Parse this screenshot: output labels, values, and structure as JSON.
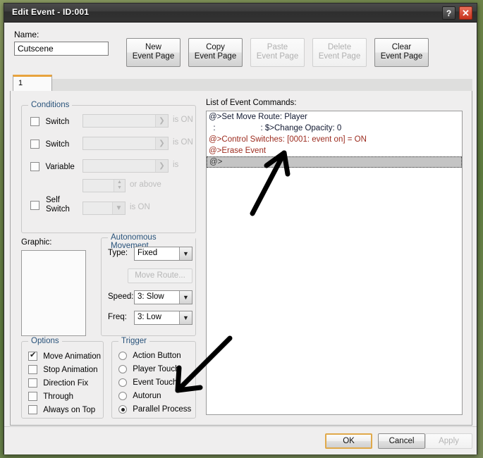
{
  "window": {
    "title": "Edit Event - ID:001",
    "help_button": "?",
    "close_button": "✕"
  },
  "name_field": {
    "label": "Name:",
    "value": "Cutscene"
  },
  "page_buttons": [
    {
      "line1": "New",
      "line2": "Event Page",
      "enabled": true
    },
    {
      "line1": "Copy",
      "line2": "Event Page",
      "enabled": true
    },
    {
      "line1": "Paste",
      "line2": "Event Page",
      "enabled": false
    },
    {
      "line1": "Delete",
      "line2": "Event Page",
      "enabled": false
    },
    {
      "line1": "Clear",
      "line2": "Event Page",
      "enabled": true
    }
  ],
  "tabs": [
    {
      "label": "1",
      "active": true
    }
  ],
  "conditions": {
    "legend": "Conditions",
    "rows": [
      {
        "label": "Switch",
        "checked": false,
        "value": "",
        "suffix": "is ON"
      },
      {
        "label": "Switch",
        "checked": false,
        "value": "",
        "suffix": "is ON"
      },
      {
        "label": "Variable",
        "checked": false,
        "value": "",
        "suffix": "is"
      },
      {
        "label": "",
        "checked": null,
        "value": "",
        "suffix": "or above"
      },
      {
        "label": "Self Switch",
        "checked": false,
        "value": "",
        "suffix": "is ON"
      }
    ]
  },
  "graphic": {
    "label": "Graphic:"
  },
  "autonomous_movement": {
    "legend": "Autonomous Movement",
    "type_label": "Type:",
    "type_value": "Fixed",
    "move_route_button": "Move Route...",
    "speed_label": "Speed:",
    "speed_value": "3: Slow",
    "freq_label": "Freq:",
    "freq_value": "3: Low"
  },
  "options": {
    "legend": "Options",
    "items": [
      {
        "label": "Move Animation",
        "checked": true
      },
      {
        "label": "Stop Animation",
        "checked": false
      },
      {
        "label": "Direction Fix",
        "checked": false
      },
      {
        "label": "Through",
        "checked": false
      },
      {
        "label": "Always on Top",
        "checked": false
      }
    ]
  },
  "trigger": {
    "legend": "Trigger",
    "items": [
      {
        "label": "Action Button",
        "selected": false
      },
      {
        "label": "Player Touch",
        "selected": false
      },
      {
        "label": "Event Touch",
        "selected": false
      },
      {
        "label": "Autorun",
        "selected": false
      },
      {
        "label": "Parallel Process",
        "selected": true
      }
    ]
  },
  "event_commands": {
    "label": "List of Event Commands:",
    "lines": [
      {
        "text": "@>Set Move Route: Player",
        "color": "#101830",
        "selected": false
      },
      {
        "text": "  :                    : $>Change Opacity: 0",
        "color": "#101830",
        "selected": false
      },
      {
        "text": "@>Control Switches: [0001: event on] = ON",
        "color": "#9c2b1e",
        "selected": false
      },
      {
        "text": "@>Erase Event",
        "color": "#9c2b1e",
        "selected": false
      },
      {
        "text": "@>",
        "color": "#1a1a1a",
        "selected": true
      }
    ]
  },
  "footer": {
    "ok": "OK",
    "cancel": "Cancel",
    "apply": "Apply"
  },
  "annotations": {
    "arrow_up": "arrow pointing up-right toward last command line",
    "arrow_down": "arrow pointing down-left toward Parallel Process"
  },
  "colors": {
    "accent": "#e8a33d",
    "legend_text": "#28527a",
    "command_red": "#9c2b1e",
    "close_button": "#c8331c"
  }
}
